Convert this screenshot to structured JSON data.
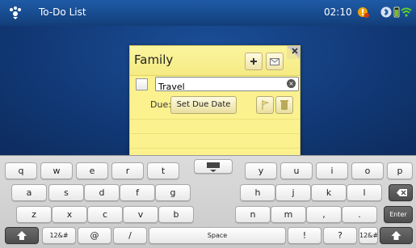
{
  "status_bar": {
    "app_title": "To-Do List",
    "time": "02:10"
  },
  "note": {
    "title": "Family",
    "task_text": "Travel",
    "due_label": "Due:",
    "set_due_button": "Set Due Date"
  },
  "keyboard": {
    "row1": [
      "q",
      "w",
      "e",
      "r",
      "t",
      "y",
      "u",
      "i",
      "o",
      "p"
    ],
    "row2": [
      "a",
      "s",
      "d",
      "f",
      "g",
      "h",
      "j",
      "k",
      "l"
    ],
    "row3": [
      "z",
      "x",
      "c",
      "v",
      "b",
      "n",
      "m",
      ",",
      "."
    ],
    "enter_label": "Enter",
    "mode_label": "12&#",
    "at_label": "@",
    "slash_label": "/",
    "space_label": "Space",
    "exclam_label": "!",
    "question_label": "?"
  }
}
